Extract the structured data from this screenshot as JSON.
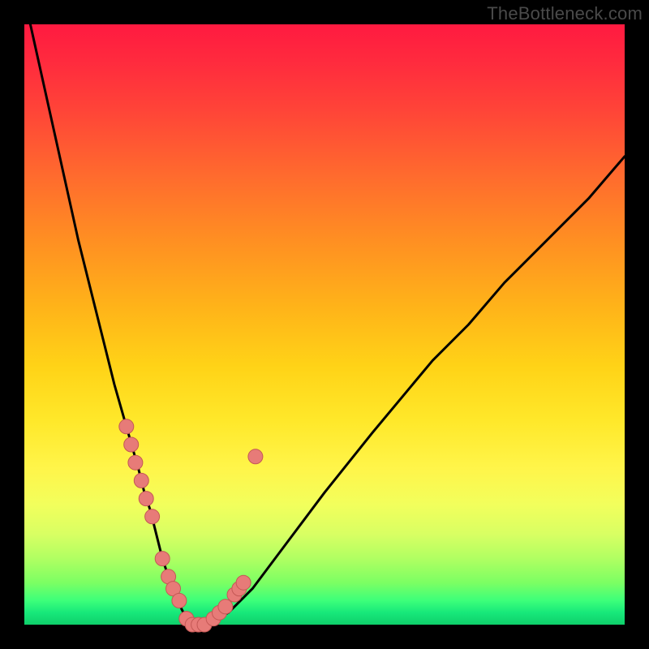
{
  "watermark": "TheBottleneck.com",
  "colors": {
    "curve": "#000000",
    "marker_fill": "#e77b78",
    "marker_stroke": "#c45855",
    "background_black": "#000000"
  },
  "chart_data": {
    "type": "line",
    "title": "",
    "xlabel": "",
    "ylabel": "",
    "xlim": [
      0,
      100
    ],
    "ylim": [
      0,
      100
    ],
    "x": [
      1,
      3,
      5,
      7,
      9,
      11,
      13,
      15,
      17,
      19,
      20,
      21,
      22,
      23,
      24,
      25,
      26,
      27,
      28,
      30,
      32,
      34,
      36,
      38,
      41,
      44,
      47,
      50,
      54,
      58,
      63,
      68,
      74,
      80,
      87,
      94,
      100
    ],
    "y": [
      100,
      91,
      82,
      73,
      64,
      56,
      48,
      40,
      33,
      26,
      22,
      19,
      15,
      11,
      8,
      5,
      3,
      1,
      0,
      0,
      1,
      2,
      4,
      6,
      10,
      14,
      18,
      22,
      27,
      32,
      38,
      44,
      50,
      57,
      64,
      71,
      78
    ],
    "markers": {
      "x": [
        17.0,
        17.8,
        18.5,
        19.5,
        20.3,
        21.3,
        23.0,
        24.0,
        24.8,
        25.8,
        27.0,
        27.0,
        28.0,
        29.0,
        30.0,
        31.5,
        32.5,
        33.5,
        35.0,
        35.8,
        36.5,
        38.5
      ],
      "y": [
        33,
        30,
        27,
        24,
        21,
        18,
        11,
        8,
        6,
        4,
        1,
        1,
        0,
        0,
        0,
        1,
        2,
        3,
        5,
        6,
        7,
        28
      ]
    }
  }
}
